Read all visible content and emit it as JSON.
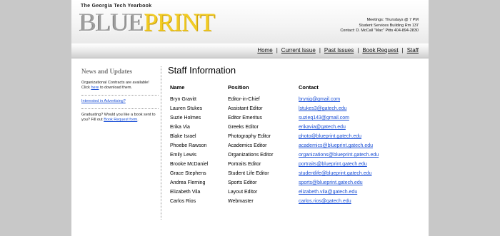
{
  "header": {
    "tagline": "The Georgia Tech Yearbook",
    "logo_part1": "BLUE",
    "logo_part2": "PRINT",
    "meetings": "Meetings: Thursdays @ 7 PM",
    "location": "Student Services Building Rm 137",
    "contact": "Contact: D. McCall \"Mac\" Pitts 404-894-2830"
  },
  "nav": {
    "items": [
      "Home",
      "Current Issue",
      "Past Issues",
      "Book Request",
      "Staff"
    ],
    "separator": "|"
  },
  "sidebar": {
    "title": "News and Updates",
    "item1_text_before": "Organizational Contracts are available! Click ",
    "item1_link": "here",
    "item1_text_after": " to download them.",
    "item2_link": "Interested in Advertising?",
    "item3_text_before": "Graduating? Would you like a book sent to you? Fill out ",
    "item3_link": "Book Request form",
    "item3_text_after": "."
  },
  "main": {
    "title": "Staff Information",
    "columns": [
      "Name",
      "Position",
      "Contact"
    ],
    "rows": [
      {
        "name": "Bryn Gravitt",
        "position": "Editor-in-Chief",
        "contact": "brynjg@gmail.com"
      },
      {
        "name": "Lauren Stukes",
        "position": "Assistant Editor",
        "contact": "lstukes3@gatech.edu"
      },
      {
        "name": "Suzie Holmes",
        "position": "Editor Emeritus",
        "contact": "suzieq143@gmail.com"
      },
      {
        "name": "Erika Via",
        "position": "Greeks Editor",
        "contact": "erikavia@gatech.edu"
      },
      {
        "name": "Blake Israel",
        "position": "Photography Editor",
        "contact": "photo@blueprint.gatech.edu"
      },
      {
        "name": "Phoebe Rawson",
        "position": "Academics Editor",
        "contact": "academics@blueprint.gatech.edu"
      },
      {
        "name": "Emily Lewis",
        "position": "Organizations Editor",
        "contact": "organizations@blueprint.gatech.edu"
      },
      {
        "name": "Brooke McDaniel",
        "position": "Portraits Editor",
        "contact": "portraits@blueprint.gatech.edu"
      },
      {
        "name": "Grace Stephens",
        "position": "Student Life Editor",
        "contact": "studentlife@blueprint.gatech.edu"
      },
      {
        "name": "Andrea Fleming",
        "position": "Sports Editor",
        "contact": "sports@blueprint.gatech.edu"
      },
      {
        "name": "Elizabeth Vila",
        "position": "Layout Editor",
        "contact": "elizabeth.vila@gatech.edu"
      },
      {
        "name": "Carlos Rios",
        "position": "Webmaster",
        "contact": "carlos.rios@gatech.edu"
      }
    ]
  },
  "colors": {
    "background": "#c8c8c8",
    "logo_gray": "#9e9e9e",
    "logo_yellow": "#f2cc23",
    "link_blue": "#1a4fd6"
  }
}
